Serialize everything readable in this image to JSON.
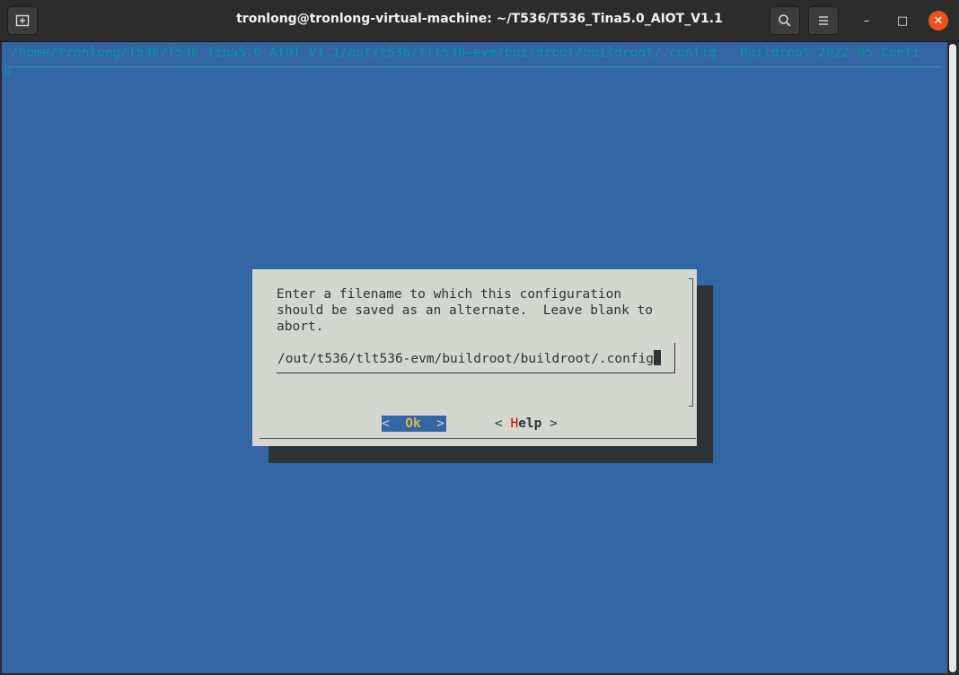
{
  "window": {
    "title": "tronlong@tronlong-virtual-machine: ~/T536/T536_Tina5.0_AIOT_V1.1",
    "new_tab_icon": "new-tab-icon",
    "search_icon": "search-icon",
    "menu_icon": "hamburger-menu-icon",
    "minimize_glyph": "–",
    "maximize_glyph": "□",
    "close_glyph": "✕"
  },
  "terminal": {
    "header_line": "/home/tronlong/T536/T536_Tina5.0_AIOT_V1.1/out/t536/tlt536-evm/buildroot/buildroot/.config - Buildroot 2022.05 Confi",
    "header_wrap": "g",
    "colors": {
      "background": "#3465a4",
      "header_text": "#06989a",
      "dialog": "#d3d7cf"
    }
  },
  "dialog": {
    "prompt": "Enter a filename to which this configuration\nshould be saved as an alternate.  Leave blank to\nabort.",
    "input_value": "/out/t536/tlt536-evm/buildroot/buildroot/.config",
    "ok_button": {
      "left": "<  ",
      "hotkey": "O",
      "rest": "k",
      "right": "  >"
    },
    "help_button": {
      "left": "< ",
      "hotkey": "H",
      "rest": "elp",
      "right": " >"
    }
  }
}
